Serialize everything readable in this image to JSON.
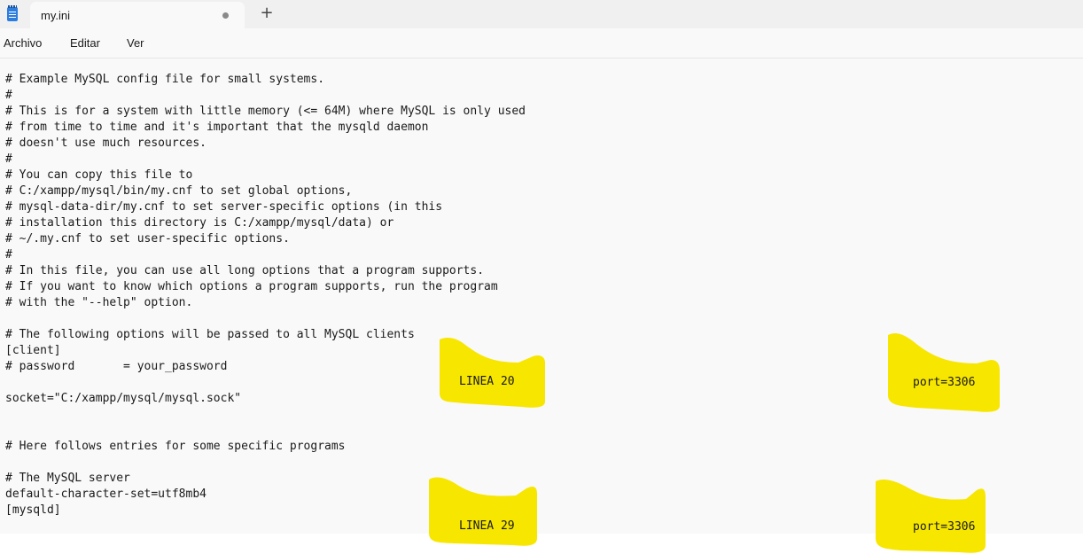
{
  "tab": {
    "title": "my.ini",
    "new_tab_glyph": "+"
  },
  "icons": {
    "app": "notepad-icon",
    "unsaved": "unsaved-dot-icon",
    "new_tab": "plus-icon"
  },
  "menu": {
    "file": "Archivo",
    "edit": "Editar",
    "view": "Ver"
  },
  "editor": {
    "lines": [
      "# Example MySQL config file for small systems.",
      "#",
      "# This is for a system with little memory (<= 64M) where MySQL is only used",
      "# from time to time and it's important that the mysqld daemon",
      "# doesn't use much resources.",
      "#",
      "# You can copy this file to",
      "# C:/xampp/mysql/bin/my.cnf to set global options,",
      "# mysql-data-dir/my.cnf to set server-specific options (in this",
      "# installation this directory is C:/xampp/mysql/data) or",
      "# ~/.my.cnf to set user-specific options.",
      "#",
      "# In this file, you can use all long options that a program supports.",
      "# If you want to know which options a program supports, run the program",
      "# with the \"--help\" option.",
      "",
      "# The following options will be passed to all MySQL clients",
      "[client]",
      "# password       = your_password",
      "",
      "socket=\"C:/xampp/mysql/mysql.sock\"",
      "",
      "",
      "# Here follows entries for some specific programs",
      "",
      "# The MySQL server",
      "default-character-set=utf8mb4",
      "[mysqld]"
    ]
  },
  "annotations": {
    "first_line_label": "LINEA 20",
    "first_port_label": "port=3306",
    "second_line_label": "LINEA 29",
    "second_port_label": "port=3306"
  },
  "colors": {
    "highlight": "#f7e600",
    "background": "#f9f9f9",
    "tabbar": "#f0f0f0"
  }
}
